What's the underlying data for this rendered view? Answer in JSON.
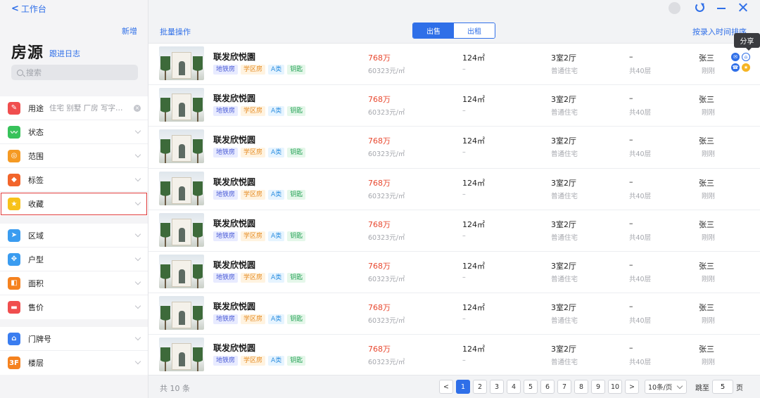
{
  "sidebar": {
    "back_label": "工作台",
    "new_label": "新增",
    "title": "房源",
    "follow_log": "跟进日志",
    "search_placeholder": "搜索",
    "groups": [
      [
        {
          "key": "usage",
          "label": "用途",
          "sub": "住宅 别墅 厂房 写字…",
          "icon": "leaf-icon",
          "color": "#f04e4e",
          "glyph": "✎",
          "clear": true
        },
        {
          "key": "status",
          "label": "状态",
          "icon": "trend-icon",
          "color": "#37c25a",
          "glyph": "〰"
        },
        {
          "key": "range",
          "label": "范围",
          "icon": "target-icon",
          "color": "#f59a23",
          "glyph": "◎"
        },
        {
          "key": "tags",
          "label": "标签",
          "icon": "tag-icon",
          "color": "#f2652b",
          "glyph": "◆"
        },
        {
          "key": "favorite",
          "label": "收藏",
          "icon": "star-icon",
          "color": "#f7c21a",
          "glyph": "★",
          "selected": true
        }
      ],
      [
        {
          "key": "district",
          "label": "区域",
          "icon": "location-arrow-icon",
          "color": "#3a9cf0",
          "glyph": "➤"
        },
        {
          "key": "room-type",
          "label": "户型",
          "icon": "layout-icon",
          "color": "#3a9cf0",
          "glyph": "✥"
        },
        {
          "key": "area",
          "label": "面积",
          "icon": "area-icon",
          "color": "#f5821f",
          "glyph": "◧"
        },
        {
          "key": "price",
          "label": "售价",
          "icon": "card-icon",
          "color": "#f04e4e",
          "glyph": "▬"
        }
      ],
      [
        {
          "key": "door-number",
          "label": "门牌号",
          "icon": "home-icon",
          "color": "#3a7df0",
          "glyph": "⌂"
        },
        {
          "key": "floor",
          "label": "楼层",
          "icon": "floor-3f-icon",
          "color": "#f5821f",
          "glyph": "3F"
        }
      ]
    ]
  },
  "toolbar": {
    "batch_label": "批量操作",
    "tab_sale": "出售",
    "tab_rent": "出租",
    "sort_label": "按录入时间排序",
    "tooltip_share": "分享"
  },
  "listings": [
    {
      "name": "联发欣悦園",
      "tags": [
        "地铁房",
        "学区房",
        "A类",
        "钥匙"
      ],
      "price": "768万",
      "unit_price": "60323元/㎡",
      "area": "124㎡",
      "area_sub": "–",
      "layout": "3室2厅",
      "layout_sub": "普通住宅",
      "floor": "–",
      "floor_sub": "共40层",
      "agent": "张三",
      "agent_sub": "刚刚",
      "actions": true
    },
    {
      "name": "联发欣悦圆",
      "tags": [
        "地铁房",
        "学区房",
        "A类",
        "钥匙"
      ],
      "price": "768万",
      "unit_price": "60323元/㎡",
      "area": "124㎡",
      "area_sub": "–",
      "layout": "3室2厅",
      "layout_sub": "普通住宅",
      "floor": "–",
      "floor_sub": "共40层",
      "agent": "张三",
      "agent_sub": "刚刚"
    },
    {
      "name": "联发欣悦圆",
      "tags": [
        "地铁房",
        "学区房",
        "A类",
        "钥匙"
      ],
      "price": "768万",
      "unit_price": "60323元/㎡",
      "area": "124㎡",
      "area_sub": "–",
      "layout": "3室2厅",
      "layout_sub": "普通住宅",
      "floor": "–",
      "floor_sub": "共40层",
      "agent": "张三",
      "agent_sub": "刚刚"
    },
    {
      "name": "联发欣悦圆",
      "tags": [
        "地铁房",
        "学区房",
        "A类",
        "钥匙"
      ],
      "price": "768万",
      "unit_price": "60323元/㎡",
      "area": "124㎡",
      "area_sub": "–",
      "layout": "3室2厅",
      "layout_sub": "普通住宅",
      "floor": "–",
      "floor_sub": "共40层",
      "agent": "张三",
      "agent_sub": "刚刚"
    },
    {
      "name": "联发欣悦圆",
      "tags": [
        "地铁房",
        "学区房",
        "A类",
        "钥匙"
      ],
      "price": "768万",
      "unit_price": "60323元/㎡",
      "area": "124㎡",
      "area_sub": "–",
      "layout": "3室2厅",
      "layout_sub": "普通住宅",
      "floor": "–",
      "floor_sub": "共40层",
      "agent": "张三",
      "agent_sub": "刚刚"
    },
    {
      "name": "联发欣悦圆",
      "tags": [
        "地铁房",
        "学区房",
        "A类",
        "钥匙"
      ],
      "price": "768万",
      "unit_price": "60323元/㎡",
      "area": "124㎡",
      "area_sub": "–",
      "layout": "3室2厅",
      "layout_sub": "普通住宅",
      "floor": "–",
      "floor_sub": "共40层",
      "agent": "张三",
      "agent_sub": "刚刚"
    },
    {
      "name": "联发欣悦圆",
      "tags": [
        "地铁房",
        "学区房",
        "A类",
        "钥匙"
      ],
      "price": "768万",
      "unit_price": "60323元/㎡",
      "area": "124㎡",
      "area_sub": "–",
      "layout": "3室2厅",
      "layout_sub": "普通住宅",
      "floor": "–",
      "floor_sub": "共40层",
      "agent": "张三",
      "agent_sub": "刚刚"
    },
    {
      "name": "联发欣悦圆",
      "tags": [
        "地铁房",
        "学区房",
        "A类",
        "钥匙"
      ],
      "price": "768万",
      "unit_price": "60323元/㎡",
      "area": "124㎡",
      "area_sub": "–",
      "layout": "3室2厅",
      "layout_sub": "普通住宅",
      "floor": "–",
      "floor_sub": "共40层",
      "agent": "张三",
      "agent_sub": "刚刚"
    }
  ],
  "row_actions": [
    {
      "name": "message-action-icon",
      "glyph": "✉",
      "style": "b"
    },
    {
      "name": "lock-action-icon",
      "glyph": "⌂",
      "style": "o"
    },
    {
      "name": "phone-action-icon",
      "glyph": "☎",
      "style": "b"
    },
    {
      "name": "favorite-action-icon",
      "glyph": "★",
      "style": "y"
    }
  ],
  "footer": {
    "total": "共 10 条",
    "pages": [
      "1",
      "2",
      "3",
      "4",
      "5",
      "6",
      "7",
      "8",
      "9",
      "10"
    ],
    "current_page": "1",
    "prev_glyph": "<",
    "next_glyph": ">",
    "page_size": "10条/页",
    "jump_label": "跳至",
    "jump_value": "5",
    "page_suffix": "页"
  },
  "colors": {
    "accent": "#2f6fe8",
    "price": "#e8472e",
    "selection_outline": "#e03b3b"
  }
}
